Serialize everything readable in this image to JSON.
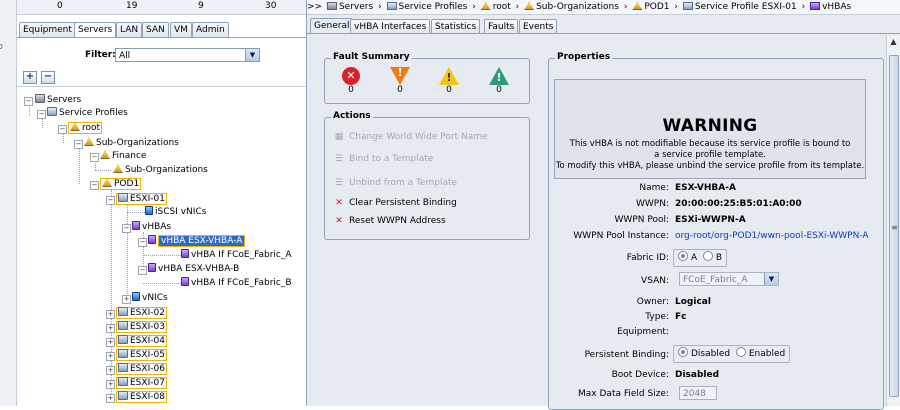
{
  "stats": {
    "values": [
      "0",
      "19",
      "9",
      "30"
    ]
  },
  "nav_tabs": [
    "Equipment",
    "Servers",
    "LAN",
    "SAN",
    "VM",
    "Admin"
  ],
  "filter": {
    "label": "Filter:",
    "value": "All"
  },
  "tree_toolbar": {
    "expand": "+",
    "collapse": "−"
  },
  "tree": {
    "servers": "Servers",
    "service_profiles": "Service Profiles",
    "root": "root",
    "sub_orgs": "Sub-Organizations",
    "finance": "Finance",
    "finance_sub_orgs": "Sub-Organizations",
    "pod1": "POD1",
    "esxi01": "ESXI-01",
    "iscsi": "iSCSI vNICs",
    "vhbas": "vHBAs",
    "vhba_a": "vHBA ESX-VHBA-A",
    "vhba_a_if": "vHBA If FCoE_Fabric_A",
    "vhba_b": "vHBA ESX-VHBA-B",
    "vhba_b_if": "vHBA If FCoE_Fabric_B",
    "vnics": "vNICs",
    "esxi": [
      "ESXI-02",
      "ESXI-03",
      "ESXI-04",
      "ESXI-05",
      "ESXI-06",
      "ESXI-07",
      "ESXI-08"
    ]
  },
  "breadcrumb": {
    "prefix": ">>",
    "items": [
      "Servers",
      "Service Profiles",
      "root",
      "Sub-Organizations",
      "POD1",
      "Service Profile ESXI-01",
      "vHBAs"
    ],
    "separator": "›"
  },
  "right_tabs": [
    "General",
    "vHBA Interfaces",
    "Statistics",
    "Faults",
    "Events"
  ],
  "fault_summary": {
    "title": "Fault Summary",
    "counts": [
      "0",
      "0",
      "0",
      "0"
    ],
    "colors": [
      "#d9232a",
      "#f07d11",
      "#f3c711",
      "#2e9a7a"
    ],
    "icons": [
      "critical-fault-icon",
      "major-fault-icon",
      "minor-fault-icon",
      "warning-fault-icon"
    ]
  },
  "actions": {
    "title": "Actions",
    "items": [
      {
        "label": "Change World Wide Port Name",
        "enabled": false,
        "icon": "wwpn-icon"
      },
      {
        "label": "Bind to a Template",
        "enabled": false,
        "icon": "bind-template-icon"
      },
      {
        "label": "Unbind from a Template",
        "enabled": false,
        "icon": "unbind-template-icon"
      },
      {
        "label": "Clear Persistent Binding",
        "enabled": true,
        "icon": "red-x-icon"
      },
      {
        "label": "Reset WWPN Address",
        "enabled": true,
        "icon": "red-x-icon"
      }
    ]
  },
  "properties": {
    "title": "Properties",
    "warning_title": "WARNING",
    "warning_lines": [
      "This vHBA is not modifiable because its service profile is bound to",
      "a service profile template.",
      "To modify this vHBA, please unbind the service profile from its template."
    ],
    "name_label": "Name:",
    "name_value": "ESX-VHBA-A",
    "wwpn_label": "WWPN:",
    "wwpn_value": "20:00:00:25:B5:01:A0:00",
    "pool_label": "WWPN Pool:",
    "pool_value": "ESXi-WWPN-A",
    "pool_instance_label": "WWPN Pool Instance:",
    "pool_instance_value": "org-root/org-POD1/wwn-pool-ESXi-WWPN-A",
    "fabric_label": "Fabric ID:",
    "fabric_a": "A",
    "fabric_b": "B",
    "vsan_label": "VSAN:",
    "vsan_value": "FCoE_Fabric_A",
    "owner_label": "Owner:",
    "owner_value": "Logical",
    "type_label": "Type:",
    "type_value": "Fc",
    "equipment_label": "Equipment:",
    "binding_label": "Persistent Binding:",
    "binding_disabled": "Disabled",
    "binding_enabled": "Enabled",
    "boot_label": "Boot Device:",
    "boot_value": "Disabled",
    "maxfield_label": "Max Data Field Size:",
    "maxfield_value": "2048"
  }
}
